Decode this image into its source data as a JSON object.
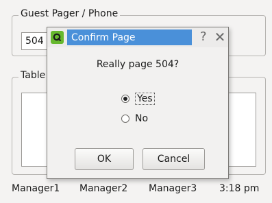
{
  "pager_group": {
    "title": "Guest Pager / Phone",
    "input_value": "504"
  },
  "table_group": {
    "title": "Table"
  },
  "footer": {
    "labels": [
      "Manager1",
      "Manager2",
      "Manager3"
    ],
    "time": "3:18 pm"
  },
  "dialog": {
    "title": "Confirm Page",
    "icon": "qt-app-icon",
    "help_label": "?",
    "close_label": "✕",
    "question": "Really page 504?",
    "options": [
      {
        "label": "Yes",
        "selected": true
      },
      {
        "label": "No",
        "selected": false
      }
    ],
    "ok_label": "OK",
    "cancel_label": "Cancel"
  }
}
